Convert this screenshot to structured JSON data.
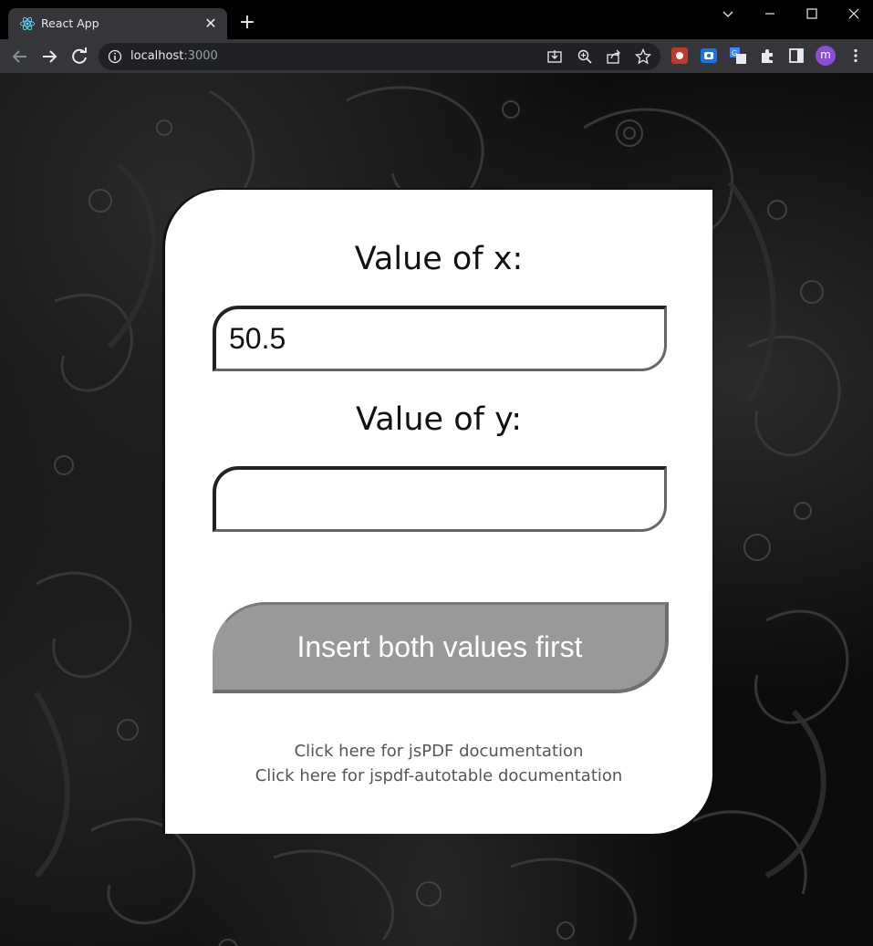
{
  "browser": {
    "tab_title": "React App",
    "url_host": "localhost",
    "url_port": ":3000",
    "profile_initial": "m"
  },
  "form": {
    "x_label": "Value of x:",
    "x_value": "50.5",
    "y_label": "Value of y:",
    "y_value": "",
    "button_label": "Insert both values first"
  },
  "links": {
    "jspdf": "Click here for jsPDF documentation",
    "autotable": "Click here for jspdf-autotable documentation"
  },
  "colors": {
    "accent_avatar": "#8a4fd8",
    "button_disabled": "#999999",
    "card": "#ffffff"
  },
  "icons": [
    "react-icon",
    "close-icon",
    "plus-icon",
    "chevron-down-icon",
    "minimize-icon",
    "maximize-icon",
    "window-close-icon",
    "back-icon",
    "forward-icon",
    "reload-icon",
    "info-icon",
    "install-icon",
    "zoom-icon",
    "share-icon",
    "star-icon",
    "extensions-icon",
    "side-panel-icon",
    "more-icon"
  ]
}
